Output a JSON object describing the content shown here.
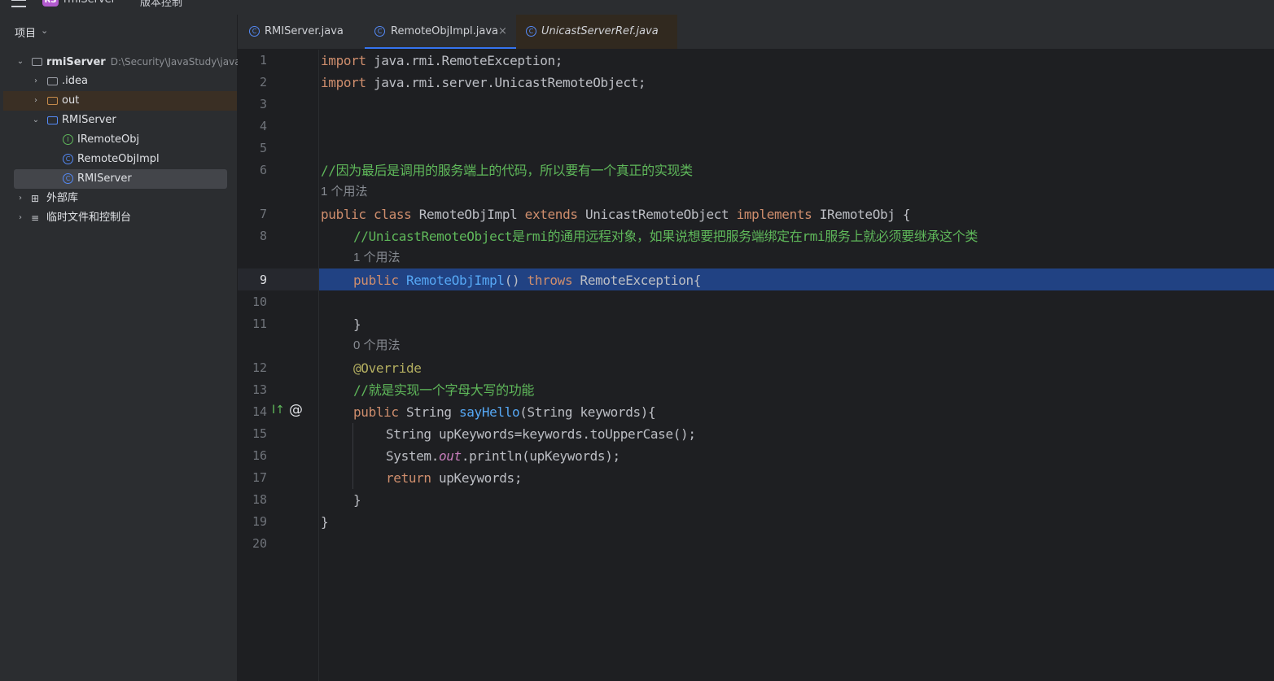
{
  "titlebar": {
    "project_badge": "RS",
    "project_name": "rmiServer",
    "vcs_label": "版本控制"
  },
  "project_panel": {
    "title": "项目",
    "tree": [
      {
        "label": "rmiServer",
        "path": "D:\\Security\\JavaStudy\\java"
      },
      {
        "label": ".idea"
      },
      {
        "label": "out"
      },
      {
        "label": "RMIServer"
      },
      {
        "label": "IRemoteObj"
      },
      {
        "label": "RemoteObjImpl"
      },
      {
        "label": "RMIServer"
      },
      {
        "label": "外部库"
      },
      {
        "label": "临时文件和控制台"
      }
    ]
  },
  "tabs": [
    {
      "label": "RMIServer.java"
    },
    {
      "label": "RemoteObjImpl.java",
      "close": "×"
    },
    {
      "label": "UnicastServerRef.java"
    }
  ],
  "icons": {
    "class_letter": "C",
    "interface_letter": "I",
    "gutter_at": "@",
    "gutter_impl": "I↑"
  },
  "editor": {
    "line_numbers": [
      "1",
      "2",
      "3",
      "4",
      "5",
      "6",
      "7",
      "8",
      "9",
      "10",
      "11",
      "12",
      "13",
      "14",
      "15",
      "16",
      "17",
      "18",
      "19",
      "20"
    ],
    "l1": {
      "kw": "import",
      "rest": " java.rmi.RemoteException;"
    },
    "l2": {
      "kw": "import",
      "rest": " java.rmi.server.UnicastRemoteObject;"
    },
    "l6": "//因为最后是调用的服务端上的代码，所以要有一个真正的实现类",
    "hint1": "1 个用法",
    "l7": {
      "kw1": "public",
      "kw2": "class",
      "name": " RemoteObjImpl ",
      "kw3": "extends",
      "sup": " UnicastRemoteObject ",
      "kw4": "implements",
      "iface": " IRemoteObj {"
    },
    "l8": "//UnicastRemoteObject是rmi的通用远程对象，如果说想要把服务端绑定在rmi服务上就必须要继承这个类",
    "hint2": "1 个用法",
    "l9": {
      "kw1": "public",
      "ctor": "RemoteObjImpl",
      "paren": "() ",
      "kw2": "throws",
      "exc": " RemoteException{"
    },
    "l11": "}",
    "hint3": "0 个用法",
    "l12": "@Override",
    "l13": "//就是实现一个字母大写的功能",
    "l14": {
      "kw": "public",
      "type": " String ",
      "method": "sayHello",
      "params": "(String keywords){"
    },
    "l15": "String upKeywords=keywords.toUpperCase();",
    "l16": {
      "pre": "System.",
      "field": "out",
      "post": ".println(upKeywords);"
    },
    "l17": {
      "kw": "return",
      "rest": " upKeywords;"
    },
    "l18": "}",
    "l19": "}"
  }
}
